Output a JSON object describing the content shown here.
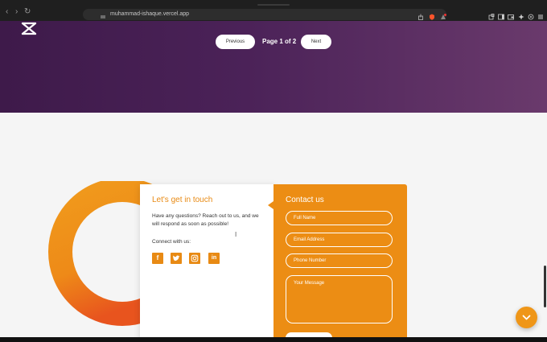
{
  "browser": {
    "url": "muhammad-ishaque.vercel.app"
  },
  "pagination": {
    "previous_label": "Previous",
    "page_text": "Page 1 of 2",
    "next_label": "Next"
  },
  "contact_info": {
    "title": "Let's get in touch",
    "description": "Have any questions? Reach out to us, and we will respond as soon as possible!",
    "connect_label": "Connect with us:",
    "socials": [
      {
        "icon": "facebook-icon",
        "glyph": "f"
      },
      {
        "icon": "twitter-icon",
        "glyph": "t"
      },
      {
        "icon": "instagram-icon",
        "glyph": "◎"
      },
      {
        "icon": "linkedin-icon",
        "glyph": "in"
      }
    ]
  },
  "contact_form": {
    "title": "Contact us",
    "name_placeholder": "Full Name",
    "email_placeholder": "Email Address",
    "phone_placeholder": "Phone Number",
    "message_placeholder": "Your Message"
  },
  "colors": {
    "accent": "#ec8d14",
    "hero_dark": "#3e1a4a",
    "hero_light": "#6a3a6c"
  }
}
